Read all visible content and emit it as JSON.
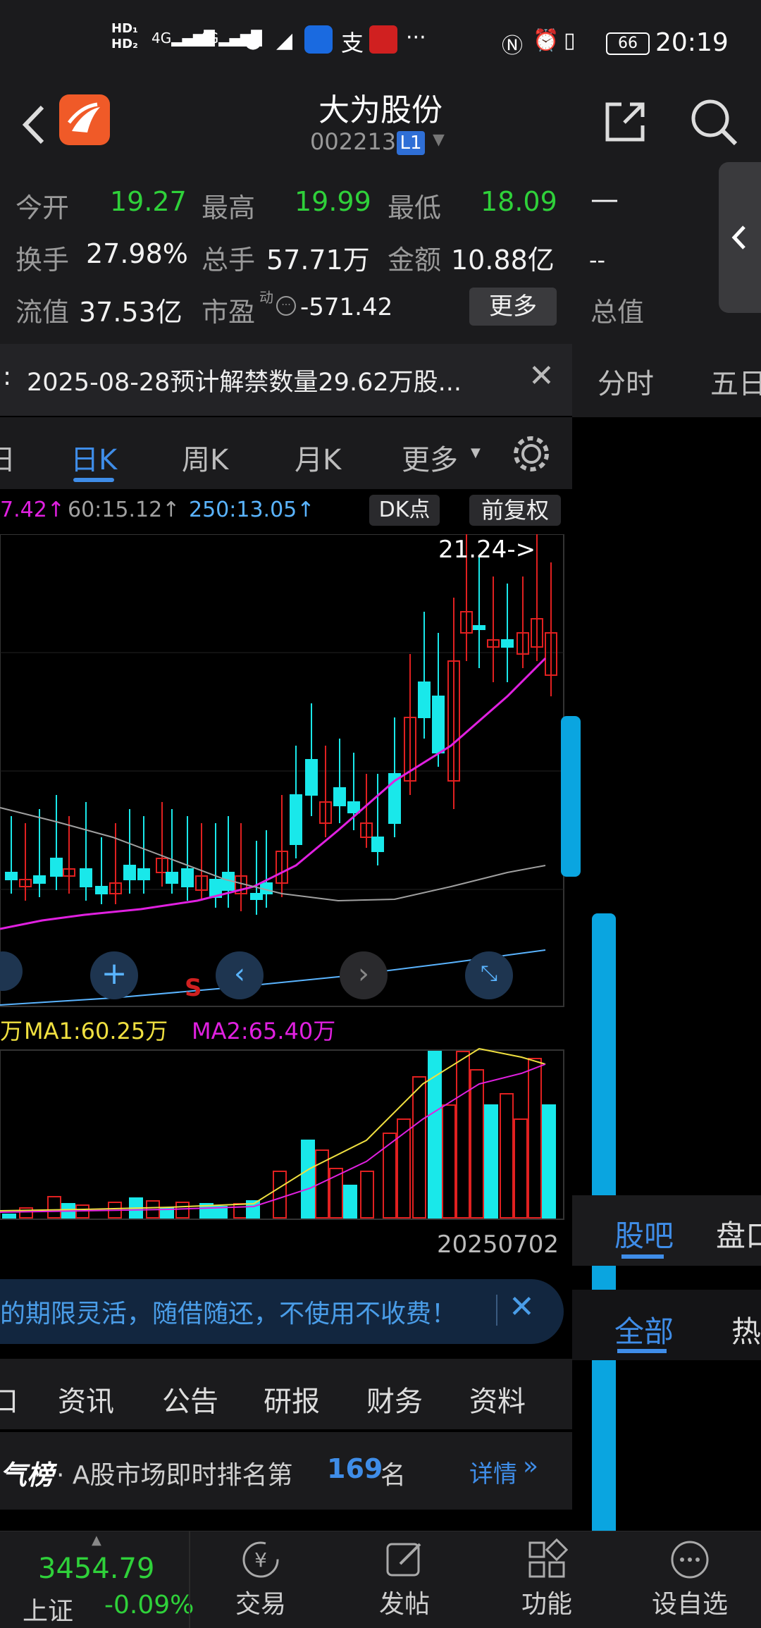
{
  "status": {
    "time": "20:19",
    "battery": "66",
    "hd1": "HD",
    "hd2": "HD",
    "net1": "4G",
    "net2": "4G",
    "more": "···"
  },
  "header": {
    "title": "大为股份",
    "code": "002213",
    "level": "L1"
  },
  "quote": {
    "open_label": "今开",
    "open": "19.27",
    "high_label": "最高",
    "high": "19.99",
    "low_label": "最低",
    "low": "18.09",
    "turnover_label": "换手",
    "turnover": "27.98%",
    "volume_label": "总手",
    "volume": "57.71万",
    "amount_label": "金额",
    "amount": "10.88亿",
    "float_label": "流值",
    "float": "37.53亿",
    "pe_label": "市盈",
    "pe_sup": "动",
    "pe": "-571.42",
    "more": "更多",
    "price": "—",
    "change": "--",
    "total_label": "总值"
  },
  "notice": {
    "prefix": ":",
    "text": "2025-08-28预计解禁数量29.62万股..."
  },
  "right_tabs": [
    "分时",
    "五日"
  ],
  "kline_tabs": [
    "日",
    "日K",
    "周K",
    "月K",
    "更多"
  ],
  "ma_row": {
    "ma1": "7.42↑",
    "ma2": "60:15.12↑",
    "ma3": "250:13.05↑",
    "dk": "DK点",
    "fq": "前复权"
  },
  "chart": {
    "peak_label": "21.24->",
    "signal": "S",
    "date": "20250702"
  },
  "volume_row": {
    "prefix": "万",
    "ma1": "MA1:60.25万",
    "ma2": "MA2:65.40万"
  },
  "colors": {
    "up": "#e02020",
    "down": "#19e8ea",
    "ma_pink": "#e020e0",
    "ma_gray": "#a0a0a0",
    "ma_blue": "#5ab4ff",
    "ma_yellow": "#f0e040",
    "accent": "#3f8de8"
  },
  "banner": {
    "text": "的期限灵活，随借随还，不使用不收费！"
  },
  "info_tabs": [
    "口",
    "资讯",
    "公告",
    "研报",
    "财务",
    "资料"
  ],
  "rank": {
    "title": "气榜",
    "text": "· A股市场即时排名第",
    "num": "169",
    "suffix": "名",
    "detail": "详情"
  },
  "right_lower": {
    "tab1": "股吧",
    "tab2": "盘口",
    "sub1": "全部",
    "sub2": "热"
  },
  "bottom": {
    "index_value": "3454.79",
    "index_name": "上证",
    "index_change": "-0.09%",
    "items": [
      "交易",
      "发帖",
      "功能",
      "设自选"
    ]
  }
}
